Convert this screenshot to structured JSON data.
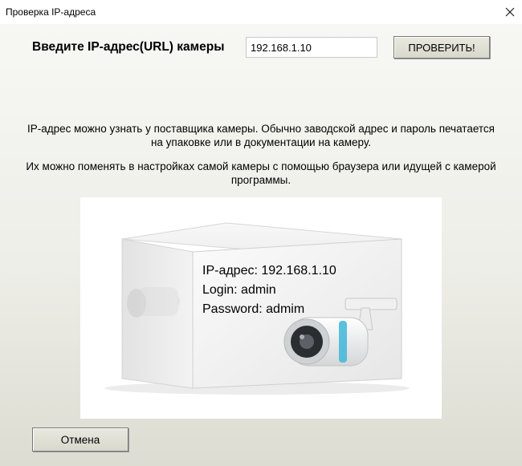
{
  "window": {
    "title": "Проверка IP-адреса",
    "close_icon": "close-icon"
  },
  "form": {
    "prompt": "Введите IP-адрес(URL) камеры",
    "ip_value": "192.168.1.10",
    "check_label": "ПРОВЕРИТЬ!"
  },
  "info": {
    "line1a": "IP-адрес можно узнать у поставщика камеры. Обычно заводской адрес и пароль печатается",
    "line1b": "на упаковке или в документации на камеру.",
    "line2a": "Их можно поменять в настройках самой камеры с помощью браузера или идущей с камерой",
    "line2b": "программы."
  },
  "box_label": {
    "ip": "IP-адрес: 192.168.1.10",
    "login": "Login: admin",
    "password": "Password: admim"
  },
  "footer": {
    "cancel_label": "Отмена"
  }
}
